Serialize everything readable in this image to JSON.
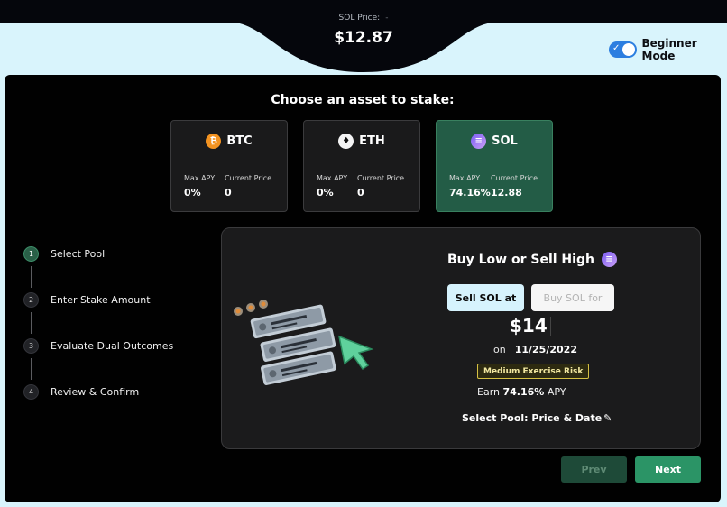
{
  "header": {
    "price_label": "SOL Price:",
    "price_dash": "-",
    "price_value": "$12.87"
  },
  "mode_toggle": {
    "label": "Beginner Mode",
    "on": true
  },
  "choose": {
    "title": "Choose an asset to stake:"
  },
  "assets": [
    {
      "name": "BTC",
      "icon": "bitcoin-icon",
      "max_apy_label": "Max APY",
      "max_apy": "0%",
      "price_label": "Current Price",
      "price": "0"
    },
    {
      "name": "ETH",
      "icon": "ethereum-icon",
      "max_apy_label": "Max APY",
      "max_apy": "0%",
      "price_label": "Current Price",
      "price": "0"
    },
    {
      "name": "SOL",
      "icon": "solana-icon",
      "max_apy_label": "Max APY",
      "max_apy": "74.16%",
      "price_label": "Current Price",
      "price": "12.88",
      "selected": true
    }
  ],
  "steps": [
    {
      "num": "1",
      "label": "Select Pool",
      "active": true
    },
    {
      "num": "2",
      "label": "Enter Stake Amount"
    },
    {
      "num": "3",
      "label": "Evaluate Dual Outcomes"
    },
    {
      "num": "4",
      "label": "Review & Confirm"
    }
  ],
  "pool": {
    "title": "Buy Low or Sell High",
    "tab_sell": "Sell SOL at",
    "tab_buy": "Buy SOL for",
    "strike": "$14",
    "on_label": "on",
    "date": "11/25/2022",
    "risk": "Medium Exercise Risk",
    "earn_prefix": "Earn",
    "earn_apy": "74.16%",
    "earn_suffix": "APY",
    "select_pool_label": "Select Pool: Price & Date"
  },
  "nav": {
    "prev": "Prev",
    "next": "Next"
  },
  "colors": {
    "accent_green": "#2b9466",
    "selected_card": "#235c46",
    "toggle_blue": "#2c7ee0",
    "background": "#d9f4fc"
  }
}
